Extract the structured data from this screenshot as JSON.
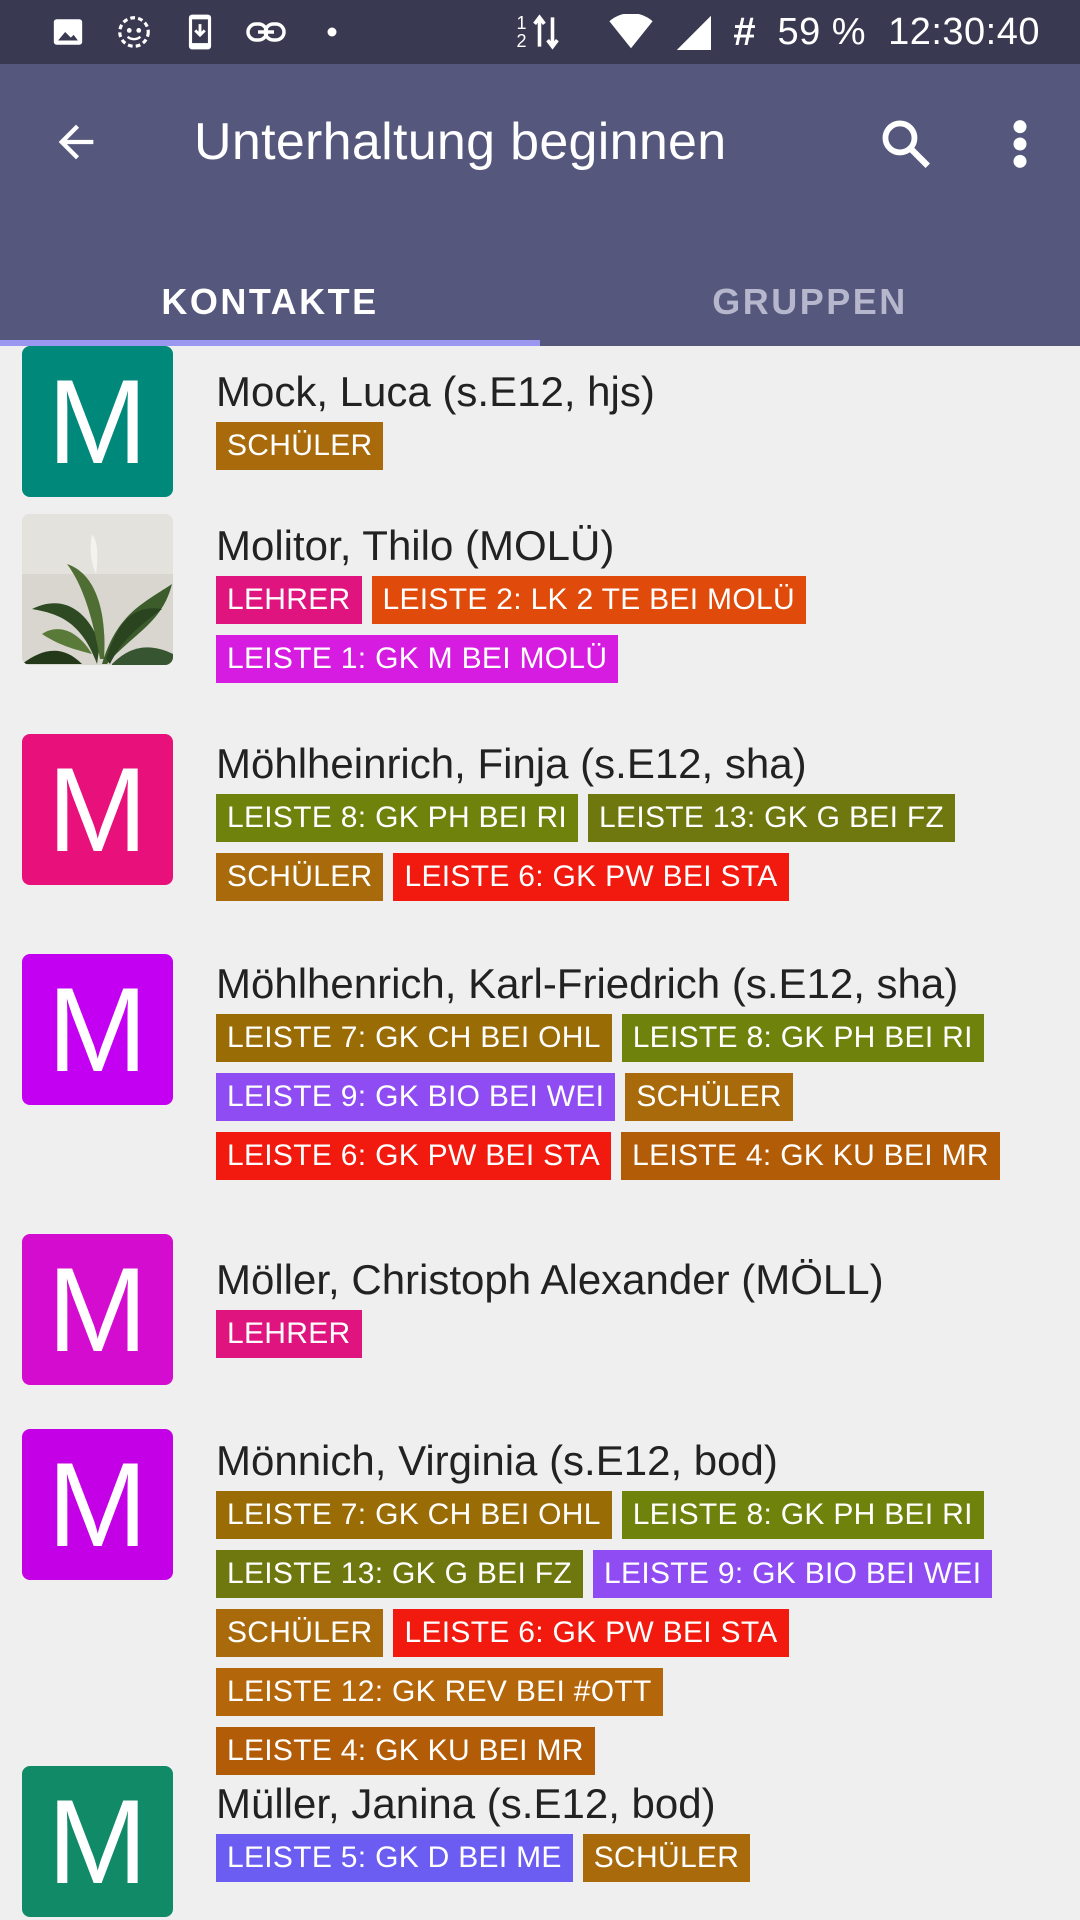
{
  "status_bar": {
    "left_icons": [
      "image-icon",
      "assistant-icon",
      "phone-download-icon",
      "link-icon",
      "dot-icon"
    ],
    "sim": "1 2",
    "battery": "59 %",
    "time": "12:30:40"
  },
  "app_bar": {
    "title": "Unterhaltung beginnen",
    "tabs": [
      {
        "label": "KONTAKTE",
        "active": true
      },
      {
        "label": "GRUPPEN",
        "active": false
      }
    ]
  },
  "colors": {
    "schueler": "#a86a0a",
    "lehrer": "#e0147e",
    "leiste2": "#e04a0a",
    "leiste1": "#d61ce0",
    "leiste8": "#6f820c",
    "leiste13": "#6f780e",
    "leiste6": "#f2190f",
    "leiste7": "#9a6c06",
    "leiste9": "#8e4cf2",
    "leiste4": "#b35c07",
    "leiste12": "#b4660a",
    "leiste5": "#6b5cf2"
  },
  "contacts": [
    {
      "name": "Mock, Luca (s.E12, hjs)",
      "avatar_letter": "M",
      "avatar_color": "#00897b",
      "tags": [
        {
          "label": "SCHÜLER",
          "color": "#a86a0a"
        }
      ]
    },
    {
      "name": "Molitor, Thilo (MOLÜ)",
      "avatar_letter": "",
      "avatar_color": "#2f4a2a",
      "avatar_photo": true,
      "tags": [
        {
          "label": "LEHRER",
          "color": "#e0147e"
        },
        {
          "label": "LEISTE 2: LK 2 TE BEI MOLÜ",
          "color": "#e04a0a"
        },
        {
          "label": "LEISTE 1: GK M BEI MOLÜ",
          "color": "#d61ce0"
        }
      ]
    },
    {
      "name": "Möhlheinrich, Finja (s.E12, sha)",
      "avatar_letter": "M",
      "avatar_color": "#e8107a",
      "tags": [
        {
          "label": "LEISTE 8: GK PH BEI RI",
          "color": "#6f820c"
        },
        {
          "label": "LEISTE 13: GK G BEI FZ",
          "color": "#6f780e"
        },
        {
          "label": "SCHÜLER",
          "color": "#a86a0a"
        },
        {
          "label": "LEISTE 6: GK PW BEI STA",
          "color": "#f2190f"
        }
      ]
    },
    {
      "name": "Möhlhenrich, Karl-Friedrich (s.E12, sha)",
      "avatar_letter": "M",
      "avatar_color": "#c400f2",
      "tags": [
        {
          "label": "LEISTE 7: GK CH BEI OHL",
          "color": "#9a6c06"
        },
        {
          "label": "LEISTE 8: GK PH BEI RI",
          "color": "#6f820c"
        },
        {
          "label": "LEISTE 9: GK BIO BEI WEI",
          "color": "#8e4cf2"
        },
        {
          "label": "SCHÜLER",
          "color": "#a86a0a"
        },
        {
          "label": "LEISTE 6: GK PW BEI STA",
          "color": "#f2190f"
        },
        {
          "label": "LEISTE 4: GK KU BEI MR",
          "color": "#b35c07"
        }
      ]
    },
    {
      "name": "Möller, Christoph Alexander (MÖLL)",
      "avatar_letter": "M",
      "avatar_color": "#d40ccf",
      "tags": [
        {
          "label": "LEHRER",
          "color": "#e0147e"
        }
      ]
    },
    {
      "name": "Mönnich, Virginia (s.E12, bod)",
      "avatar_letter": "M",
      "avatar_color": "#c400e6",
      "tags": [
        {
          "label": "LEISTE 7: GK CH BEI OHL",
          "color": "#9a6c06"
        },
        {
          "label": "LEISTE 8: GK PH BEI RI",
          "color": "#6f820c"
        },
        {
          "label": "LEISTE 13: GK G BEI FZ",
          "color": "#6f780e"
        },
        {
          "label": "LEISTE 9: GK BIO BEI WEI",
          "color": "#8e4cf2"
        },
        {
          "label": "SCHÜLER",
          "color": "#a86a0a"
        },
        {
          "label": "LEISTE 6: GK PW BEI STA",
          "color": "#f2190f"
        },
        {
          "label": "LEISTE 12: GK REV BEI #OTT",
          "color": "#b4660a"
        },
        {
          "label": "LEISTE 4: GK KU BEI MR",
          "color": "#b35c07"
        }
      ]
    },
    {
      "name": "Müller, Janina (s.E12, bod)",
      "avatar_letter": "M",
      "avatar_color": "#118a68",
      "tags": [
        {
          "label": "LEISTE 5: GK D BEI ME",
          "color": "#6b5cf2"
        },
        {
          "label": "SCHÜLER",
          "color": "#a86a0a"
        }
      ]
    }
  ]
}
